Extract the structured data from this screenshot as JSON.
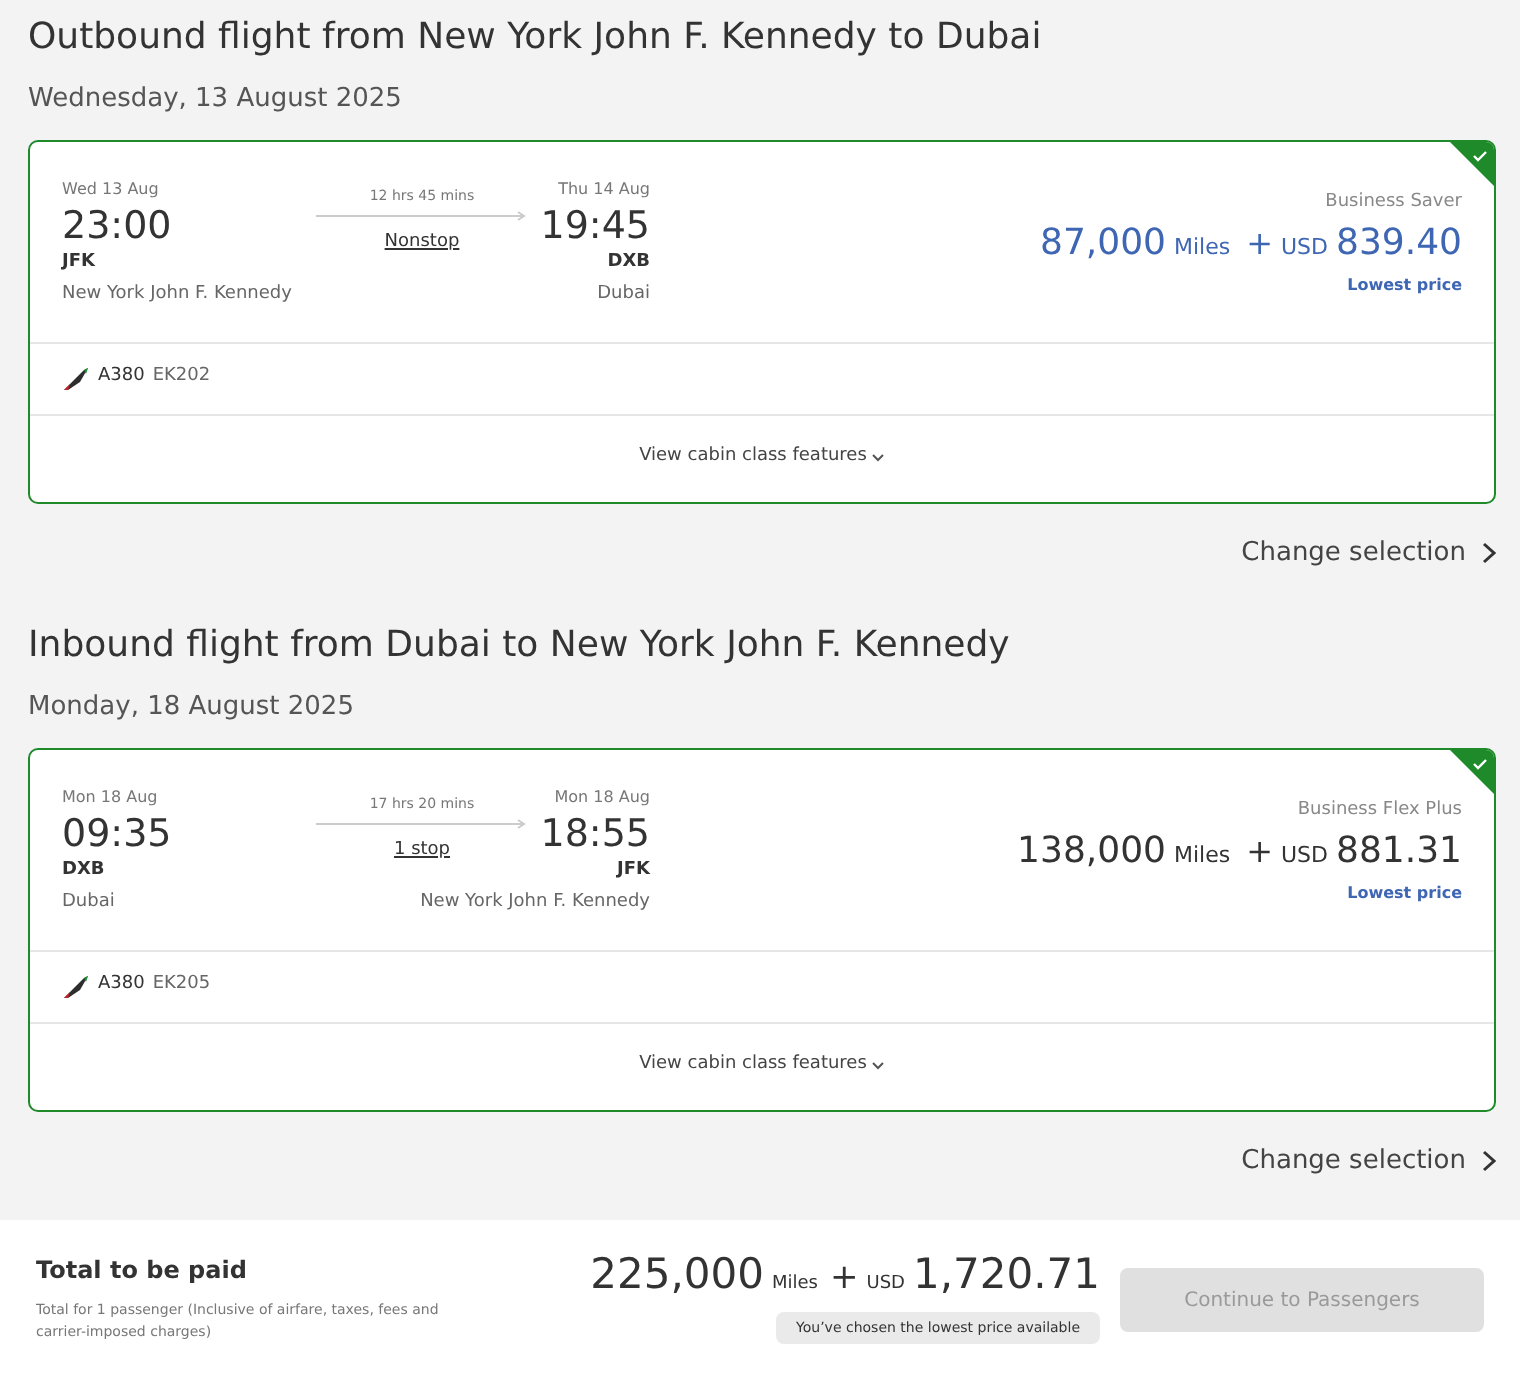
{
  "flights": [
    {
      "heading": "Outbound flight from New York John F. Kennedy to Dubai",
      "date": "Wednesday, 13 August 2025",
      "selected": true,
      "depart": {
        "date": "Wed 13 Aug",
        "time": "23:00",
        "code": "JFK",
        "city": "New York John F. Kennedy"
      },
      "arrive": {
        "date": "Thu 14 Aug",
        "time": "19:45",
        "code": "DXB",
        "city": "Dubai"
      },
      "duration": "12 hrs 45 mins",
      "stops": "Nonstop",
      "fare": "Business Saver",
      "price": {
        "highlighted": true,
        "miles": "87,000",
        "miles_unit": "Miles",
        "plus": "+",
        "currency": "USD",
        "amount": "839.40"
      },
      "price_note": "Lowest price",
      "aircraft": "A380",
      "flight_number": "EK202",
      "features_link": "View cabin class features",
      "change": "Change selection"
    },
    {
      "heading": "Inbound flight from Dubai to New York John F. Kennedy",
      "date": "Monday, 18 August 2025",
      "selected": true,
      "depart": {
        "date": "Mon 18 Aug",
        "time": "09:35",
        "code": "DXB",
        "city": "Dubai"
      },
      "arrive": {
        "date": "Mon 18 Aug",
        "time": "18:55",
        "code": "JFK",
        "city": "New York John F. Kennedy"
      },
      "duration": "17 hrs 20 mins",
      "stops": "1 stop",
      "fare": "Business Flex Plus",
      "price": {
        "highlighted": false,
        "miles": "138,000",
        "miles_unit": "Miles",
        "plus": "+",
        "currency": "USD",
        "amount": "881.31"
      },
      "price_note": "Lowest price",
      "aircraft": "A380",
      "flight_number": "EK205",
      "features_link": "View cabin class features",
      "change": "Change selection"
    }
  ],
  "footer": {
    "title": "Total to be paid",
    "note": "Total for 1 passenger (Inclusive of airfare, taxes, fees and carrier-imposed charges)",
    "miles": "225,000",
    "miles_unit": "Miles",
    "plus": "+",
    "currency": "USD",
    "amount": "1,720.71",
    "badge": "You’ve chosen the lowest price available",
    "button": {
      "label": "Continue to Passengers",
      "disabled": true
    }
  }
}
